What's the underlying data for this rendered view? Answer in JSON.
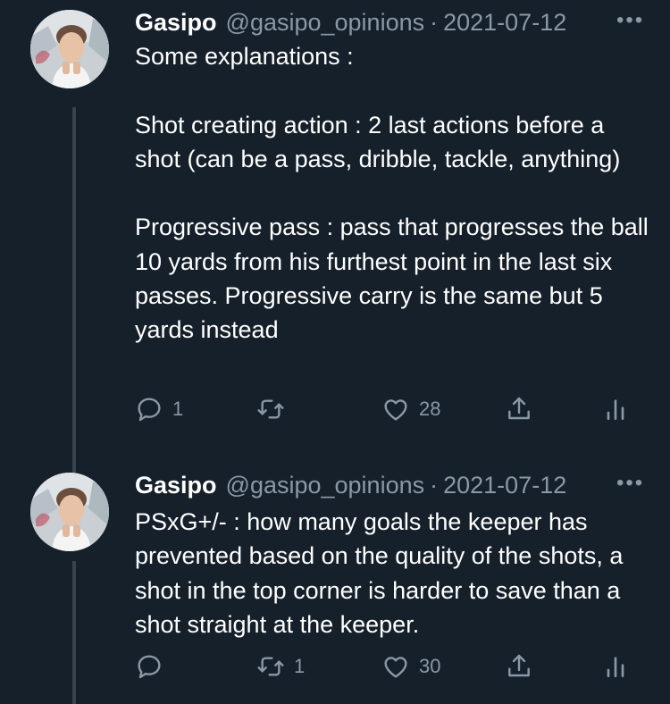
{
  "colors": {
    "background": "#15202b",
    "text_primary": "#ffffff",
    "text_secondary": "#8b98a5",
    "thread_line": "#38444d"
  },
  "tweets": [
    {
      "author_name": "Gasipo",
      "handle": "@gasipo_opinions",
      "separator": "·",
      "date": "2021-07-12",
      "more_label": "•••",
      "paragraphs": [
        "Some explanations :",
        "",
        "Shot creating action : 2 last actions before a shot (can be a pass, dribble, tackle, anything)",
        "",
        "Progressive pass : pass that progresses the ball 10 yards from his furthest point in the last six passes. Progressive carry is the same but 5 yards instead"
      ],
      "reply_count": "1",
      "retweet_count": "",
      "like_count": "28",
      "reply_icon": "reply-icon",
      "retweet_icon": "retweet-icon",
      "like_icon": "heart-icon",
      "share_icon": "share-icon",
      "analytics_icon": "analytics-icon"
    },
    {
      "author_name": "Gasipo",
      "handle": "@gasipo_opinions",
      "separator": "·",
      "date": "2021-07-12",
      "more_label": "•••",
      "paragraphs": [
        "PSxG+/- : how many goals the keeper has prevented based on the quality of the shots, a shot in the top corner is harder to save than a shot straight at the keeper."
      ],
      "reply_count": "",
      "retweet_count": "1",
      "like_count": "30",
      "reply_icon": "reply-icon",
      "retweet_icon": "retweet-icon",
      "like_icon": "heart-icon",
      "share_icon": "share-icon",
      "analytics_icon": "analytics-icon"
    }
  ]
}
